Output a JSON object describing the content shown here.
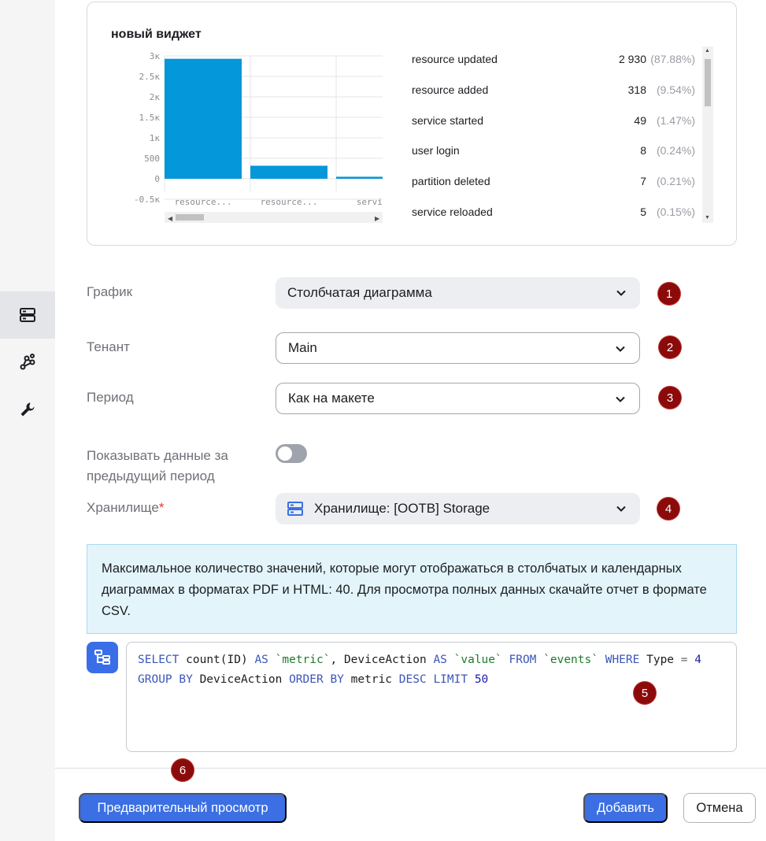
{
  "rail": {
    "items": [
      {
        "icon": "storage-icon",
        "active": true
      },
      {
        "icon": "graph-icon",
        "active": false
      },
      {
        "icon": "wrench-icon",
        "active": false
      }
    ]
  },
  "widget": {
    "title": "новый виджет",
    "legend": [
      {
        "name": "resource updated",
        "value": "2 930",
        "pct": "(87.88%)"
      },
      {
        "name": "resource added",
        "value": "318",
        "pct": "(9.54%)"
      },
      {
        "name": "service started",
        "value": "49",
        "pct": "(1.47%)"
      },
      {
        "name": "user login",
        "value": "8",
        "pct": "(0.24%)"
      },
      {
        "name": "partition deleted",
        "value": "7",
        "pct": "(0.21%)"
      },
      {
        "name": "service reloaded",
        "value": "5",
        "pct": "(0.15%)"
      }
    ]
  },
  "chart_data": {
    "type": "bar",
    "title": "новый виджет",
    "categories": [
      "resource...",
      "resource...",
      "service"
    ],
    "values": [
      2930,
      318,
      49
    ],
    "y_ticks": [
      "3к",
      "2.5к",
      "2к",
      "1.5к",
      "1к",
      "500",
      "0",
      "-0.5к"
    ],
    "ylim": [
      -500,
      3000
    ],
    "bar_color": "#0497d9",
    "grid": true
  },
  "form": {
    "chart_label": "График",
    "chart_value": "Столбчатая диаграмма",
    "tenant_label": "Тенант",
    "tenant_value": "Main",
    "period_label": "Период",
    "period_value": "Как на макете",
    "prev_label_1": "Показывать данные за",
    "prev_label_2": "предыдущий период",
    "prev_enabled": false,
    "storage_label": "Хранилище",
    "storage_required": "*",
    "storage_value": "Хранилище: [OOTB] Storage"
  },
  "badges": [
    "1",
    "2",
    "3",
    "4",
    "5",
    "6"
  ],
  "info_text": "Максимальное количество значений, которые могут отображаться в столбчатых и календарных диаграммах в форматах PDF и HTML: 40. Для просмотра полных данных скачайте отчет в формате CSV.",
  "sql": {
    "select": "SELECT",
    "fn": "count(ID)",
    "as1": "AS",
    "alias1": "`metric`",
    "comma": ", DeviceAction",
    "as2": "AS",
    "alias2": "`value`",
    "from": "FROM",
    "table": "`events`",
    "where": "WHERE",
    "type_field": "Type",
    "eq": "=",
    "type_value": "4",
    "group_by": "GROUP BY",
    "group_field": "DeviceAction",
    "order_by": "ORDER BY",
    "order_field": "metric",
    "desc": "DESC",
    "limit": "LIMIT",
    "limit_value": "50"
  },
  "buttons": {
    "preview": "Предварительный просмотр",
    "add": "Добавить",
    "cancel": "Отмена"
  },
  "colors": {
    "primary": "#3b6fe3",
    "badge": "#8b0a0a",
    "info_bg": "#e3f5fb"
  }
}
